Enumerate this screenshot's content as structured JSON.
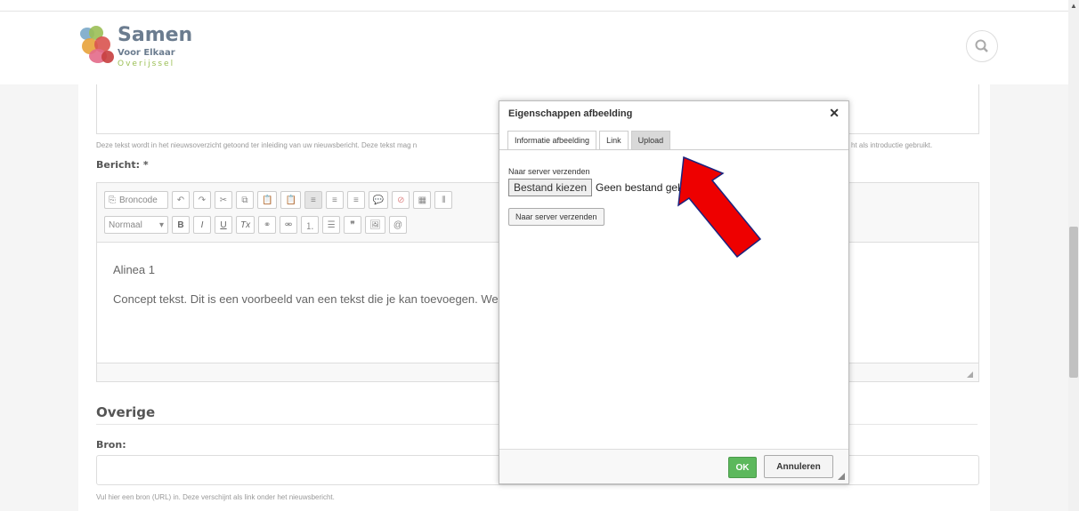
{
  "site": {
    "logo_line1": "Samen",
    "logo_line2": "Voor Elkaar",
    "logo_line3": "Overijssel"
  },
  "form": {
    "intro_help": "Deze tekst wordt in het nieuwsoverzicht getoond ter inleiding van uw nieuwsbericht. Deze tekst mag n",
    "intro_help_tail": "ht als introductie gebruikt.",
    "bericht_label": "Bericht: *",
    "source_mode": "Broncode",
    "format_select": "Normaal",
    "paragraph1": "Alinea 1",
    "paragraph2": "Concept tekst. Dit is een voorbeeld van een tekst die je kan toevoegen. We",
    "section_title": "Overige",
    "bron_label": "Bron:",
    "bron_help": "Vul hier een bron (URL) in. Deze verschijnt als link onder het nieuwsbericht."
  },
  "dialog": {
    "title": "Eigenschappen afbeelding",
    "close": "✕",
    "tabs": [
      "Informatie afbeelding",
      "Link",
      "Upload"
    ],
    "send_label": "Naar server verzenden",
    "file_button": "Bestand kiezen",
    "file_status": "Geen bestand gek",
    "send_button": "Naar server verzenden",
    "ok": "OK",
    "cancel": "Annuleren"
  },
  "colors": {
    "ok_green": "#5cb85c",
    "arrow_red": "#ee0000",
    "arrow_outline": "#1a237e"
  }
}
